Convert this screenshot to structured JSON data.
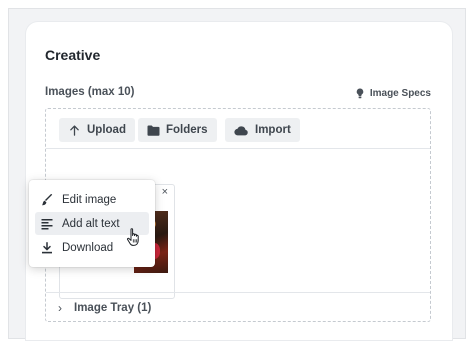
{
  "card": {
    "title": "Creative",
    "images_label": "Images (max 10)",
    "specs_label": "Image Specs",
    "specs_icon": "lightbulb-icon"
  },
  "toolbar": {
    "upload_label": "Upload",
    "upload_icon": "arrow-up-icon",
    "folders_label": "Folders",
    "folders_icon": "folder-icon",
    "import_label": "Import",
    "import_icon": "cloud-icon"
  },
  "tile": {
    "menu_glyph": "•••",
    "close_glyph": "×"
  },
  "context_menu": {
    "items": [
      {
        "label": "Edit image",
        "icon": "paintbrush-icon"
      },
      {
        "label": "Add alt text",
        "icon": "text-align-left-icon",
        "highlighted": true
      },
      {
        "label": "Download",
        "icon": "download-icon"
      }
    ]
  },
  "tray": {
    "chevron": "›",
    "label": "Image Tray (1)"
  },
  "colors": {
    "page_bg": "#f2f3f5",
    "button_bg": "#eef0f2",
    "text": "#2b3138",
    "hover_bg": "#eceef1"
  }
}
